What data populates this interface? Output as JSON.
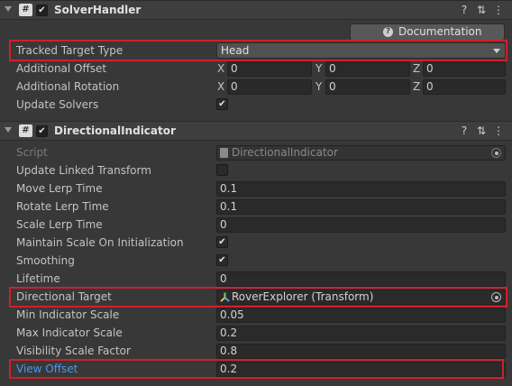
{
  "solver_handler": {
    "title": "SolverHandler",
    "documentation_label": "Documentation",
    "tracked_target_type": {
      "label": "Tracked Target Type",
      "value": "Head"
    },
    "additional_offset": {
      "label": "Additional Offset",
      "x": "0",
      "y": "0",
      "z": "0"
    },
    "additional_rotation": {
      "label": "Additional Rotation",
      "x": "0",
      "y": "0",
      "z": "0"
    },
    "update_solvers": {
      "label": "Update Solvers",
      "checked": true
    }
  },
  "directional_indicator": {
    "title": "DirectionalIndicator",
    "script": {
      "label": "Script",
      "value": "DirectionalIndicator"
    },
    "update_linked_transform": {
      "label": "Update Linked Transform",
      "checked": false
    },
    "move_lerp_time": {
      "label": "Move Lerp Time",
      "value": "0.1"
    },
    "rotate_lerp_time": {
      "label": "Rotate Lerp Time",
      "value": "0.1"
    },
    "scale_lerp_time": {
      "label": "Scale Lerp Time",
      "value": "0"
    },
    "maintain_scale": {
      "label": "Maintain Scale On Initialization",
      "checked": true
    },
    "smoothing": {
      "label": "Smoothing",
      "checked": true
    },
    "lifetime": {
      "label": "Lifetime",
      "value": "0"
    },
    "directional_target": {
      "label": "Directional Target",
      "value": "RoverExplorer (Transform)"
    },
    "min_indicator_scale": {
      "label": "Min Indicator Scale",
      "value": "0.05"
    },
    "max_indicator_scale": {
      "label": "Max Indicator Scale",
      "value": "0.2"
    },
    "visibility_scale_factor": {
      "label": "Visibility Scale Factor",
      "value": "0.8"
    },
    "view_offset": {
      "label": "View Offset",
      "value": "0.2"
    }
  },
  "axis_labels": {
    "x": "X",
    "y": "Y",
    "z": "Z"
  },
  "colors": {
    "highlight": "#d0202a",
    "modified_label": "#4f97e8",
    "background": "#383838"
  }
}
